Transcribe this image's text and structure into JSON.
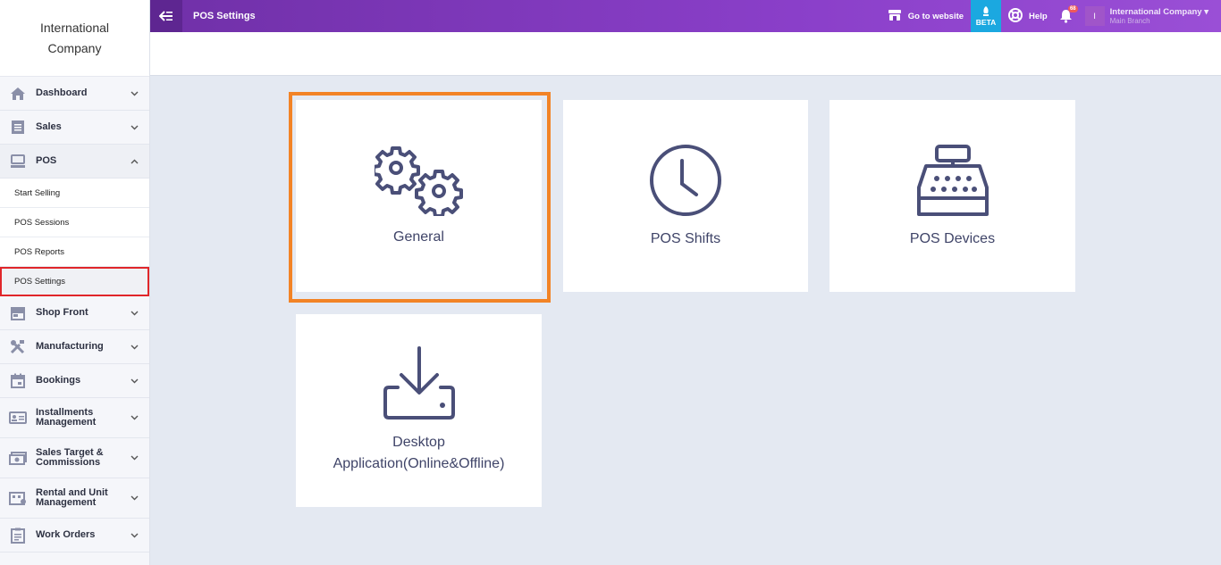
{
  "brand": {
    "line1": "International",
    "line2": "Company"
  },
  "topbar": {
    "title": "POS Settings",
    "go_to_website": "Go to website",
    "beta": "BETA",
    "help": "Help",
    "notifications_count": "68",
    "user_initial": "I",
    "user_name": "International Company",
    "user_branch": "Main Branch"
  },
  "sidebar": {
    "items": [
      {
        "label": "Dashboard",
        "icon": "home-icon"
      },
      {
        "label": "Sales",
        "icon": "receipt-icon"
      },
      {
        "label": "POS",
        "icon": "pos-terminal-icon",
        "expanded": true
      },
      {
        "label": "Shop Front",
        "icon": "storefront-icon"
      },
      {
        "label": "Manufacturing",
        "icon": "tools-icon"
      },
      {
        "label": "Bookings",
        "icon": "calendar-icon"
      },
      {
        "label": "Installments Management",
        "icon": "id-card-icon"
      },
      {
        "label": "Sales Target & Commissions",
        "icon": "money-icon"
      },
      {
        "label": "Rental and Unit Management",
        "icon": "building-icon"
      },
      {
        "label": "Work Orders",
        "icon": "clipboard-icon"
      }
    ],
    "pos_sub": [
      {
        "label": "Start Selling"
      },
      {
        "label": "POS Sessions"
      },
      {
        "label": "POS Reports"
      },
      {
        "label": "POS Settings",
        "active": true
      }
    ]
  },
  "cards": [
    {
      "label": "General",
      "icon": "gears-icon"
    },
    {
      "label": "POS Shifts",
      "icon": "clock-icon"
    },
    {
      "label": "POS Devices",
      "icon": "cash-register-icon"
    },
    {
      "label_line1": "Desktop",
      "label_line2": "Application(Online&Offline)",
      "icon": "download-icon"
    }
  ],
  "colors": {
    "topbar": "#7a35b8",
    "highlight": "#f28326",
    "active_outline": "#e0262a",
    "beta": "#1ba8e0"
  }
}
